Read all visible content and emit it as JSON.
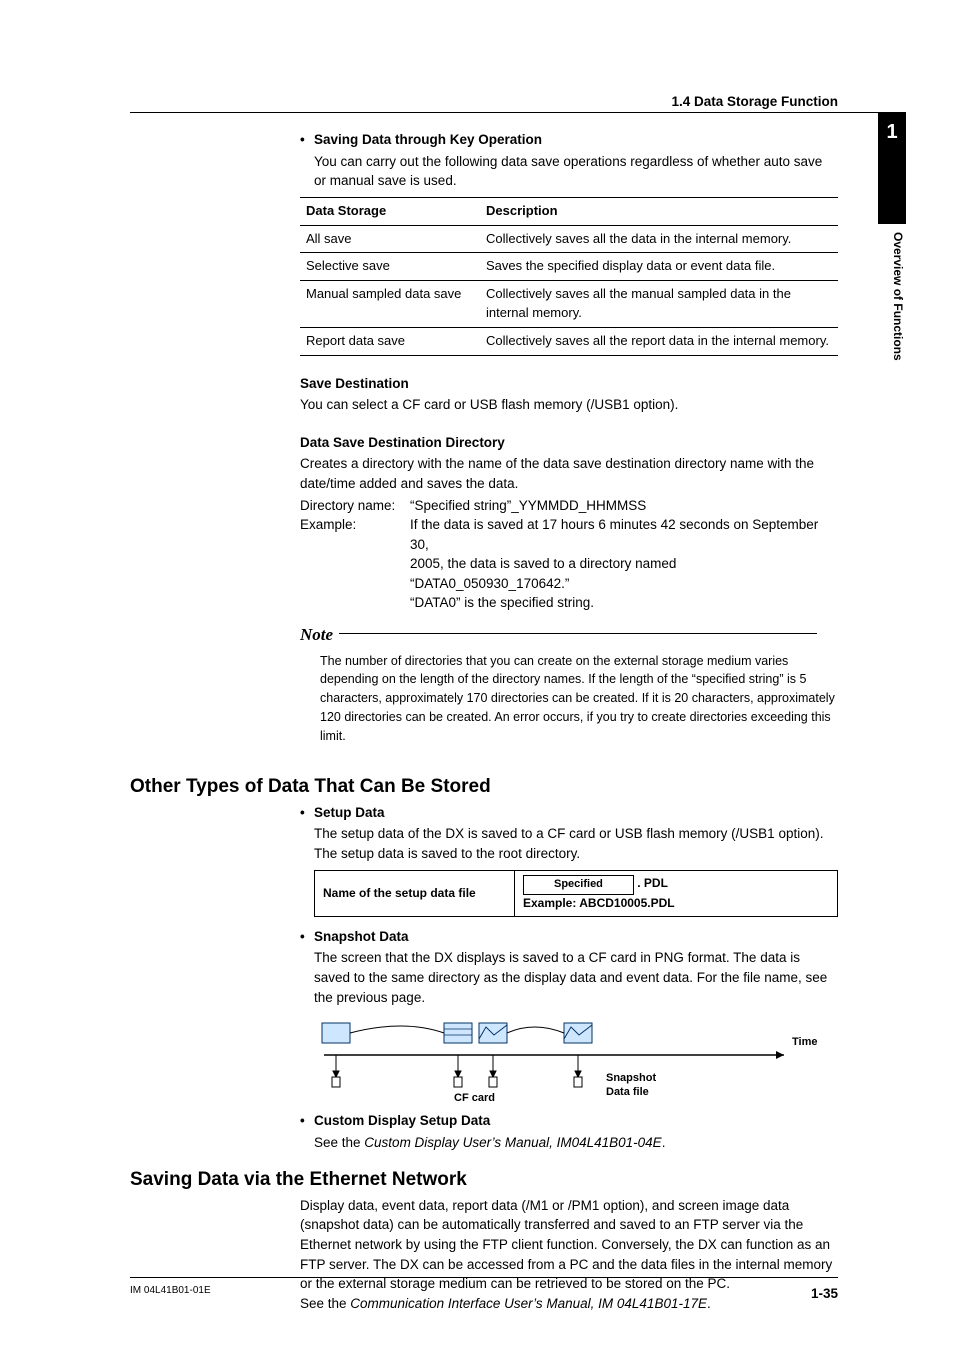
{
  "header": {
    "breadcrumb": "1.4  Data Storage Function"
  },
  "sidebar": {
    "chapter_num": "1",
    "chapter_title": "Overview of Functions"
  },
  "s1": {
    "head": "Saving Data through Key Operation",
    "para": "You can carry out the following data save operations regardless of whether auto save or manual save is used.",
    "tbl": {
      "h1": "Data Storage",
      "h2": "Description",
      "rows": [
        {
          "a": "All save",
          "b": "Collectively saves all the data in the internal memory."
        },
        {
          "a": "Selective save",
          "b": "Saves the specified display data or event data file."
        },
        {
          "a": "Manual sampled data save",
          "b": "Collectively saves all the manual sampled data in the internal memory."
        },
        {
          "a": "Report data save",
          "b": "Collectively saves all the report data in the internal memory."
        }
      ]
    }
  },
  "s2": {
    "head": "Save Destination",
    "para": "You can select a CF card or USB flash memory (/USB1 option)."
  },
  "s3": {
    "head": "Data Save Destination Directory",
    "para": "Creates a directory with the name of the data save destination directory name with the date/time added and saves the data.",
    "dir_lbl": "Directory name:",
    "dir_val": "“Specified string”_YYMMDD_HHMMSS",
    "ex_lbl": "Example:",
    "ex_val1": "If the data is saved at 17 hours 6 minutes 42 seconds on September 30,",
    "ex_val2": "2005, the data is saved to a directory named “DATA0_050930_170642.”",
    "ex_val3": "“DATA0” is the specified string."
  },
  "note": {
    "title": "Note",
    "body": "The number of directories that you can create on the external storage medium varies depending on the length of the directory names. If the length of the “specified string” is 5 characters, approximately 170 directories can be created. If it is 20 characters, approximately 120 directories can be created. An error occurs, if you try to create directories exceeding this limit."
  },
  "h2a": "Other Types of Data That Can Be Stored",
  "s4": {
    "head": "Setup Data",
    "para": "The setup data of the DX is saved to a CF card or USB flash memory (/USB1 option). The setup data is saved to the root directory.",
    "row_label": "Name of the setup data file",
    "spec": "Specified",
    "ext": ". PDL",
    "example": "Example:  ABCD10005.PDL"
  },
  "s5": {
    "head": "Snapshot Data",
    "para": "The screen that the DX displays is saved to a CF card in PNG format. The data is saved to the same directory as the display data and event data. For the file name, see the previous page.",
    "diagram": {
      "time": "Time",
      "cf": "CF card",
      "snap1": "Snapshot",
      "snap2": "Data file"
    }
  },
  "s6": {
    "head": "Custom Display Setup Data",
    "para_pre": "See the ",
    "para_em": "Custom Display User’s Manual, IM04L41B01-04E",
    "para_post": "."
  },
  "h2b": "Saving Data via the Ethernet Network",
  "s7": {
    "para": "Display data, event data, report data (/M1 or /PM1 option), and screen image data (snapshot data) can be automatically transferred and saved to an FTP server via the Ethernet network by using the FTP client function. Conversely, the DX can function as an FTP server. The DX can be accessed from a PC and the data files in the internal memory or the external storage medium can be retrieved to be stored on the PC.",
    "see_pre": "See the ",
    "see_em": "Communication Interface User’s Manual, IM 04L41B01-17E",
    "see_post": "."
  },
  "footer": {
    "doc": "IM 04L41B01-01E",
    "page": "1-35"
  }
}
